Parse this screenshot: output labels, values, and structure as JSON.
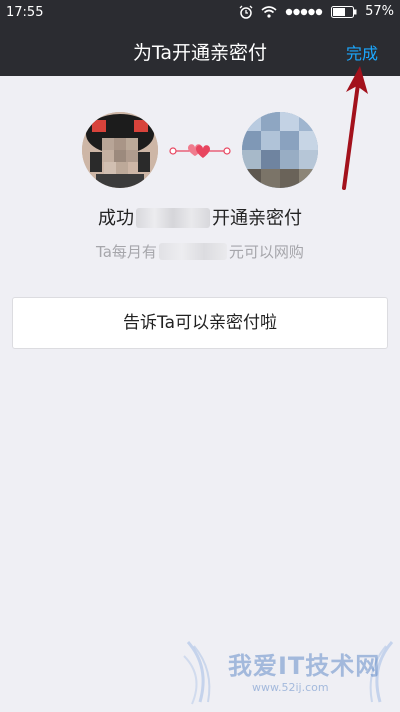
{
  "status_bar": {
    "time": "17:55",
    "battery_percent": "57%",
    "icons": [
      "alarm-icon",
      "wifi-icon",
      "signal-dots-icon",
      "battery-icon"
    ]
  },
  "nav": {
    "title": "为Ta开通亲密付",
    "done_label": "完成"
  },
  "content": {
    "success_prefix": "成功",
    "success_suffix": "开通亲密付",
    "limit_prefix": "Ta每月有",
    "limit_suffix": "元可以网购",
    "tell_button_label": "告诉Ta可以亲密付啦"
  },
  "watermark": {
    "text": "我爱IT技术网",
    "url": "www.52ij.com"
  },
  "colors": {
    "nav_bg": "#2b2c31",
    "accent": "#1ba8ff",
    "page_bg": "#efeff4",
    "heart": "#e8455f",
    "annotation_arrow": "#a3111c"
  }
}
